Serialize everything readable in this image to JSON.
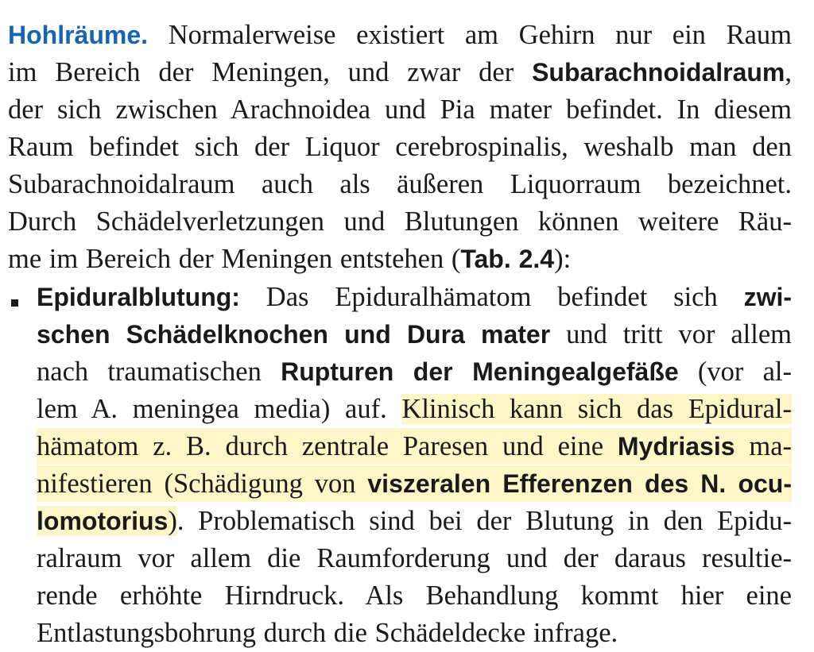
{
  "paragraph": {
    "heading": "Hohlräume.",
    "l1": "Normalerweise existiert am Gehirn nur ein Raum",
    "l2a": "im Bereich der Meningen, und zwar der ",
    "l2b": "Subarachnoidalraum",
    "l2c": ",",
    "l3": "der sich zwischen Arachnoidea und Pia mater befindet. In diesem",
    "l4": "Raum befindet sich der Liquor cerebrospinalis, weshalb man den",
    "l5": "Subarachnoidalraum auch als äußeren Liquorraum bezeichnet.",
    "l6": "Durch Schädelverletzungen und Blutungen können weitere Räu-",
    "l7a": "me im Bereich der Meningen entstehen (",
    "l7b": "Tab. 2.4",
    "l7c": "):"
  },
  "bullet": {
    "b1a": "Epiduralblutung:",
    "b1b": " Das Epiduralhämatom befindet sich ",
    "b1c": "zwi-",
    "b2a": "schen Schädelknochen und Dura mater",
    "b2b": " und tritt vor allem",
    "b3a": "nach traumatischen ",
    "b3b": "Rupturen der Meningealgefäße",
    "b3c": " (vor al-",
    "b4a": "lem A. meningea media) auf. ",
    "b4b": "Klinisch kann sich das Epidural-",
    "b5a": "hämatom z. B. durch zentrale Paresen und eine ",
    "b5b": "Mydriasis",
    "b5c": " ma-",
    "b6a": "nifestieren (Schädigung von ",
    "b6b": "viszeralen Efferenzen des N. ocu-",
    "b7a": "lomotorius",
    "b7b": ")",
    "b7c": ". Problematisch sind bei der Blutung in den Epidu-",
    "b8": "ralraum vor allem die Raumforderung und der daraus resultie-",
    "b9": "rende erhöhte Hirndruck. Als Behandlung kommt hier eine",
    "b10": "Entlastungsbohrung durch die Schädeldecke infrage."
  },
  "colors": {
    "heading": "#1565b0",
    "highlight": "#fdf7c8",
    "text": "#1a1a1a"
  }
}
